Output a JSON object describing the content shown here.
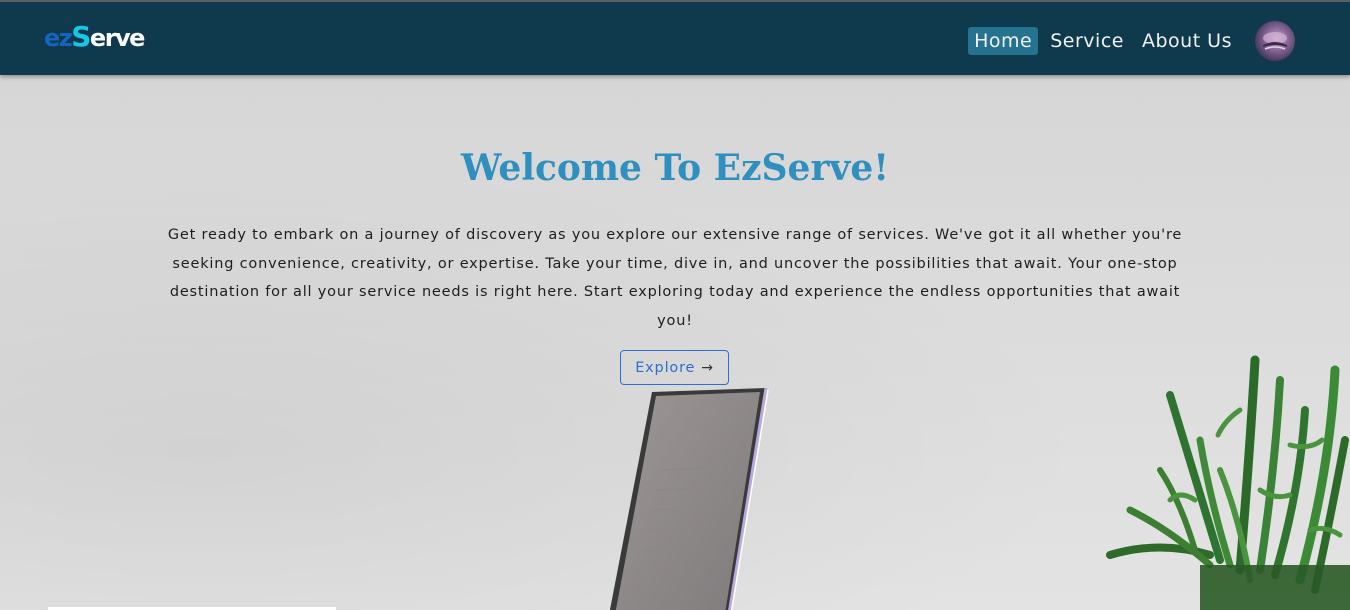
{
  "brand": {
    "logo_ez": "ez",
    "logo_s": "S",
    "logo_rest": "erve"
  },
  "nav": {
    "items": [
      {
        "label": "Home",
        "active": true
      },
      {
        "label": "Service",
        "active": false
      },
      {
        "label": "About Us",
        "active": false
      }
    ]
  },
  "hero": {
    "title": "Welcome To EzServe!",
    "description": "Get ready to embark on a journey of discovery as you explore our extensive range of services. We've got it all whether you're seeking convenience, creativity, or expertise. Take your time, dive in, and uncover the possibilities that await. Your one-stop destination for all your service needs is right here. Start exploring today and experience the endless opportunities that await you!",
    "explore_label": "Explore",
    "explore_icon": "→"
  },
  "colors": {
    "navbar": "#0f3a4e",
    "nav_active": "#26738f",
    "title": "#2f8fbf",
    "button": "#2d6fcf"
  }
}
